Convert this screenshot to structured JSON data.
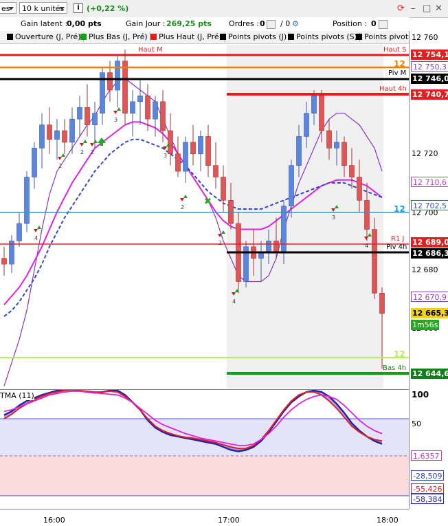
{
  "toolbar": {
    "instrument_partial": "es",
    "size": "10 k unités",
    "info_icon": "i",
    "change": "(+0,22 %)"
  },
  "infobar": {
    "latent_label": "Gain latent :",
    "latent_value": "0,00 pts",
    "day_label": "Gain Jour :",
    "day_value": "269,25 pts",
    "orders_label": "Ordres :",
    "orders_value": "0",
    "orders_count": "/ 0",
    "position_label": "Position :",
    "position_value": "0"
  },
  "legend": [
    {
      "label": "Ouverture (J, Pré)",
      "color": "#000000"
    },
    {
      "label": "Plus Bas (J, Pré)",
      "color": "#11a011"
    },
    {
      "label": "Plus Haut (J, Pré)",
      "color": "#e02020"
    },
    {
      "label": "Points pivots (J)",
      "color": "#000000"
    },
    {
      "label": "Points pivots (S)",
      "color": "#000000"
    },
    {
      "label": "Points pivots",
      "color": "#000000"
    }
  ],
  "axis_ticks": [
    "12 760",
    "12 720",
    "12 700",
    "12 680",
    "12 660"
  ],
  "price_tags": [
    {
      "text": "12 754,1",
      "bg": "#e02020",
      "fg": "#ffffff",
      "bold": true
    },
    {
      "text": "12 750,3",
      "bg": "#ffffff",
      "fg": "#8844cc",
      "bold": false
    },
    {
      "text": "12 746,0",
      "bg": "#000000",
      "fg": "#ffffff",
      "bold": true
    },
    {
      "text": "12 740,7",
      "bg": "#e02020",
      "fg": "#ffffff",
      "bold": true
    },
    {
      "text": "12 710,6",
      "bg": "#ffffff",
      "fg": "#cc33cc",
      "bold": false
    },
    {
      "text": "12 702,5",
      "bg": "#ffffff",
      "fg": "#3355cc",
      "bold": false
    },
    {
      "text": "12 689,0",
      "bg": "#e02020",
      "fg": "#ffffff",
      "bold": true
    },
    {
      "text": "12 686,3",
      "bg": "#000000",
      "fg": "#ffffff",
      "bold": true
    },
    {
      "text": "12 670,9",
      "bg": "#ffffff",
      "fg": "#8844cc",
      "bold": false
    },
    {
      "text": "12 665,3",
      "bg": "#f0d020",
      "fg": "#000000",
      "bold": true
    },
    {
      "text": "1m56s",
      "bg": "#22a822",
      "fg": "#ffffff",
      "bold": false
    },
    {
      "text": "12 644,6",
      "bg": "#11801a",
      "fg": "#ffffff",
      "bold": true
    }
  ],
  "level_labels": {
    "haut_m": "Haut M",
    "haut_s": "Haut S",
    "piv_m": "Piv M",
    "haut_4h": "Haut 4h",
    "r1_j": "R1 J",
    "piv_4h": "Piv 4h",
    "bas_4h": "Bas 4h",
    "orange_12": "12",
    "cyan_12": "12",
    "lime_12": "12"
  },
  "oscillator": {
    "name": "TMA (11)",
    "ticks": [
      "100",
      "50"
    ],
    "tags": [
      {
        "text": "1,6357",
        "fg": "#cc33cc"
      },
      {
        "text": "-28,509",
        "fg": "#3344aa"
      },
      {
        "text": "-55,426",
        "fg": "#cc2222"
      },
      {
        "text": "-58,384",
        "fg": "#2222aa"
      }
    ]
  },
  "times": [
    "16:00",
    "17:00",
    "18:00"
  ],
  "signal_numbers": [
    "4",
    "2",
    "2",
    "2",
    "3",
    "3",
    "2",
    "2",
    "4",
    "3",
    "4"
  ],
  "chart_data": {
    "type": "candlestick",
    "candles": [
      [
        12684,
        12688,
        12678,
        12682
      ],
      [
        12682,
        12692,
        12679,
        12690
      ],
      [
        12690,
        12700,
        12688,
        12696
      ],
      [
        12696,
        12714,
        12693,
        12712
      ],
      [
        12712,
        12724,
        12708,
        12722
      ],
      [
        12722,
        12734,
        12715,
        12730
      ],
      [
        12730,
        12736,
        12720,
        12725
      ],
      [
        12725,
        12732,
        12718,
        12728
      ],
      [
        12728,
        12732,
        12720,
        12724
      ],
      [
        12724,
        12736,
        12720,
        12732
      ],
      [
        12732,
        12740,
        12726,
        12736
      ],
      [
        12736,
        12744,
        12726,
        12730
      ],
      [
        12730,
        12738,
        12722,
        12734
      ],
      [
        12734,
        12750,
        12730,
        12748
      ],
      [
        12748,
        12752,
        12738,
        12742
      ],
      [
        12742,
        12754,
        12736,
        12752
      ],
      [
        12752,
        12756,
        12730,
        12734
      ],
      [
        12734,
        12742,
        12726,
        12738
      ],
      [
        12738,
        12746,
        12730,
        12740
      ],
      [
        12740,
        12744,
        12728,
        12732
      ],
      [
        12732,
        12740,
        12726,
        12738
      ],
      [
        12738,
        12742,
        12724,
        12728
      ],
      [
        12728,
        12734,
        12716,
        12720
      ],
      [
        12720,
        12726,
        12712,
        12714
      ],
      [
        12714,
        12726,
        12710,
        12724
      ],
      [
        12724,
        12730,
        12716,
        12720
      ],
      [
        12720,
        12728,
        12714,
        12726
      ],
      [
        12726,
        12730,
        12712,
        12716
      ],
      [
        12716,
        12724,
        12708,
        12712
      ],
      [
        12712,
        12716,
        12700,
        12704
      ],
      [
        12704,
        12710,
        12694,
        12696
      ],
      [
        12696,
        12700,
        12672,
        12676
      ],
      [
        12676,
        12690,
        12674,
        12688
      ],
      [
        12688,
        12694,
        12678,
        12684
      ],
      [
        12684,
        12690,
        12676,
        12686
      ],
      [
        12686,
        12694,
        12682,
        12690
      ],
      [
        12690,
        12698,
        12684,
        12686
      ],
      [
        12686,
        12704,
        12682,
        12702
      ],
      [
        12702,
        12718,
        12698,
        12716
      ],
      [
        12716,
        12730,
        12712,
        12726
      ],
      [
        12726,
        12738,
        12722,
        12734
      ],
      [
        12734,
        12742,
        12730,
        12740
      ],
      [
        12740,
        12742,
        12724,
        12728
      ],
      [
        12728,
        12732,
        12718,
        12722
      ],
      [
        12722,
        12728,
        12716,
        12724
      ],
      [
        12724,
        12726,
        12712,
        12716
      ],
      [
        12716,
        12722,
        12708,
        12712
      ],
      [
        12712,
        12718,
        12700,
        12704
      ],
      [
        12704,
        12710,
        12690,
        12694
      ],
      [
        12694,
        12698,
        12670,
        12672
      ],
      [
        12672,
        12674,
        12646,
        12665
      ]
    ],
    "series": [
      {
        "values": [
          12640,
          12648,
          12656,
          12666,
          12680,
          12694,
          12706,
          12714,
          12718,
          12722,
          12726,
          12730,
          12733,
          12738,
          12742,
          12745,
          12746,
          12744,
          12742,
          12740,
          12738,
          12732,
          12726,
          12720,
          12716,
          12712,
          12708,
          12704,
          12698,
          12690,
          12684,
          12678,
          12676,
          12676,
          12676,
          12678,
          12684,
          12694,
          12702,
          12710,
          12716,
          12722,
          12728,
          12732,
          12734,
          12734,
          12732,
          12730,
          12726,
          12722,
          12714
        ]
      },
      {
        "values": [
          12668,
          12671,
          12674,
          12678,
          12683,
          12688,
          12694,
          12700,
          12705,
          12710,
          12714,
          12718,
          12722,
          12724,
          12726,
          12728,
          12730,
          12731,
          12731,
          12730,
          12729,
          12727,
          12724,
          12720,
          12716,
          12712,
          12708,
          12704,
          12700,
          12697,
          12695,
          12694,
          12694,
          12694,
          12694,
          12695,
          12697,
          12699,
          12701,
          12703,
          12705,
          12707,
          12709,
          12710,
          12711,
          12711,
          12711,
          12710,
          12709,
          12707,
          12705
        ]
      },
      {
        "values": [
          12664,
          12666,
          12669,
          12673,
          12677,
          12682,
          12688,
          12693,
          12698,
          12702,
          12706,
          12710,
          12714,
          12717,
          12720,
          12722,
          12724,
          12725,
          12725,
          12724,
          12723,
          12722,
          12720,
          12718,
          12716,
          12713,
          12710,
          12707,
          12705,
          12703,
          12702,
          12701,
          12701,
          12701,
          12701,
          12702,
          12703,
          12704,
          12705,
          12706,
          12707,
          12708,
          12709,
          12710,
          12710,
          12710,
          12709,
          12708,
          12707,
          12706,
          12705
        ]
      }
    ],
    "osc": [
      {
        "values": [
          55,
          60,
          68,
          74,
          78,
          82,
          85,
          88,
          90,
          90,
          88,
          86,
          85,
          86,
          88,
          88,
          82,
          72,
          62,
          48,
          38,
          32,
          28,
          26,
          24,
          22,
          20,
          18,
          16,
          12,
          8,
          6,
          8,
          12,
          20,
          32,
          46,
          60,
          72,
          80,
          86,
          88,
          86,
          80,
          70,
          58,
          44,
          34,
          26,
          20,
          16
        ]
      },
      {
        "values": [
          50,
          56,
          64,
          70,
          76,
          80,
          84,
          86,
          88,
          89,
          88,
          87,
          86,
          86,
          87,
          86,
          80,
          72,
          62,
          50,
          40,
          34,
          30,
          27,
          25,
          24,
          22,
          20,
          18,
          15,
          12,
          10,
          10,
          14,
          22,
          34,
          48,
          62,
          74,
          82,
          86,
          86,
          82,
          74,
          64,
          52,
          40,
          32,
          26,
          22,
          20
        ]
      },
      {
        "values": [
          60,
          62,
          66,
          70,
          74,
          78,
          82,
          84,
          86,
          87,
          87,
          86,
          85,
          84,
          83,
          82,
          78,
          72,
          64,
          56,
          48,
          42,
          38,
          34,
          30,
          27,
          24,
          22,
          20,
          18,
          16,
          14,
          14,
          16,
          22,
          30,
          40,
          52,
          62,
          70,
          76,
          80,
          82,
          80,
          76,
          68,
          58,
          48,
          40,
          34,
          30
        ]
      }
    ],
    "xlabels": [
      "16:00",
      "17:00",
      "18:00"
    ]
  }
}
